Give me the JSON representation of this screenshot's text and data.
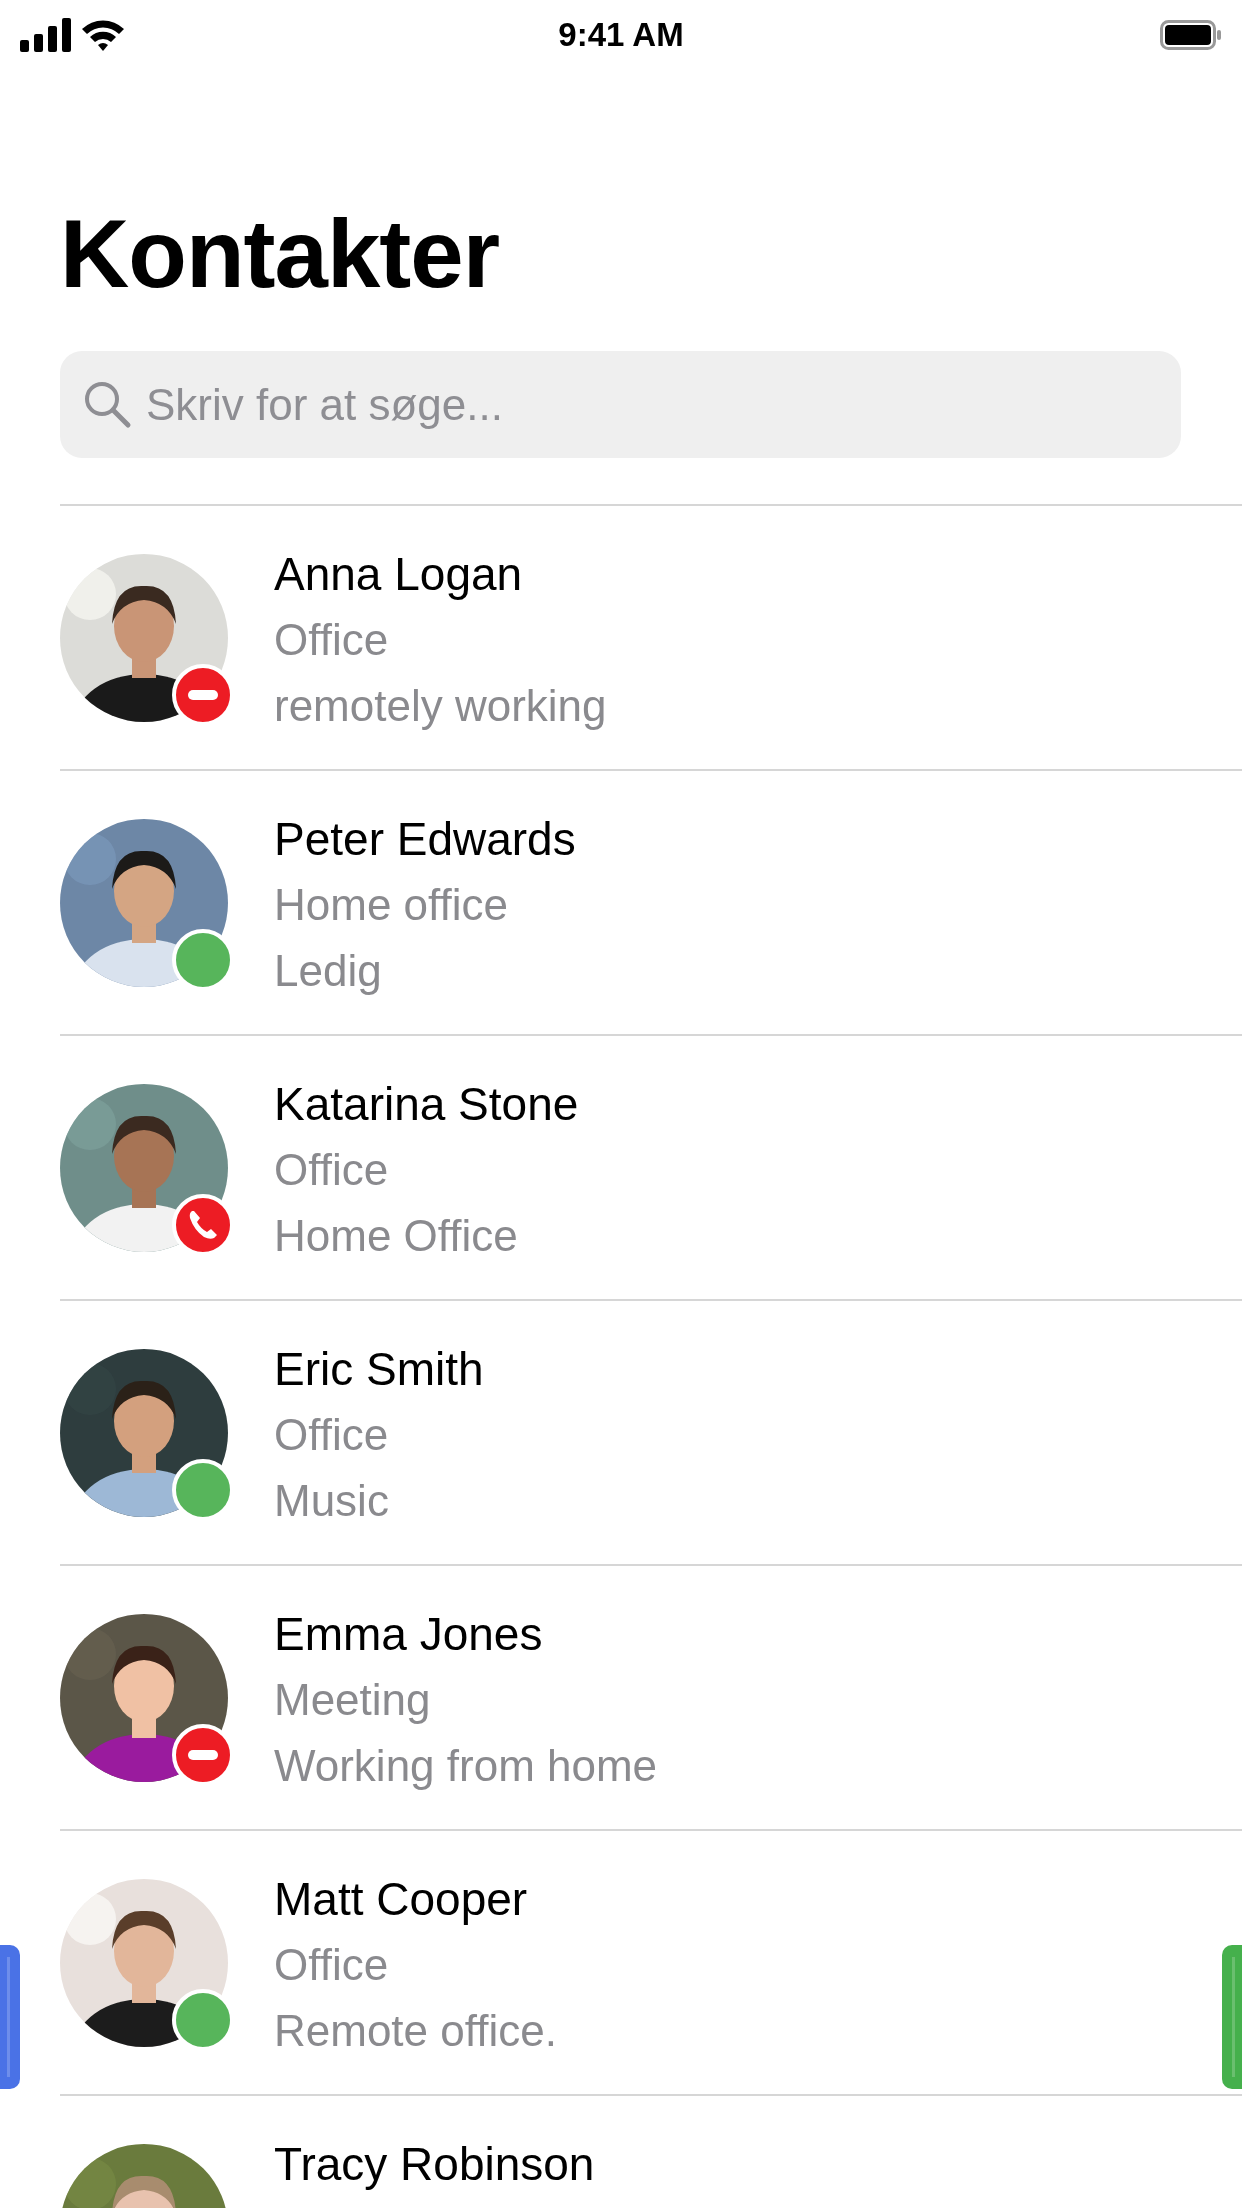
{
  "status_bar": {
    "time": "9:41 AM"
  },
  "title": "Kontakter",
  "search": {
    "placeholder": "Skriv for at søge..."
  },
  "contacts": [
    {
      "name": "Anna Logan",
      "location": "Office",
      "note": "remotely working",
      "kind": "busy"
    },
    {
      "name": "Peter Edwards",
      "location": "Home office",
      "note": "Ledig",
      "kind": "available"
    },
    {
      "name": "Katarina Stone",
      "location": "Office",
      "note": "Home Office",
      "kind": "call"
    },
    {
      "name": "Eric Smith",
      "location": "Office",
      "note": "Music",
      "kind": "available"
    },
    {
      "name": "Emma Jones",
      "location": "Meeting",
      "note": "Working from home",
      "kind": "busy"
    },
    {
      "name": "Matt Cooper",
      "location": "Office",
      "note": "Remote office.",
      "kind": "available"
    },
    {
      "name": "Tracy Robinson"
    }
  ],
  "edge_tabs": [
    {
      "kind": "left",
      "color": "#4a72e6"
    },
    {
      "kind": "right",
      "color": "#45b04c"
    }
  ]
}
